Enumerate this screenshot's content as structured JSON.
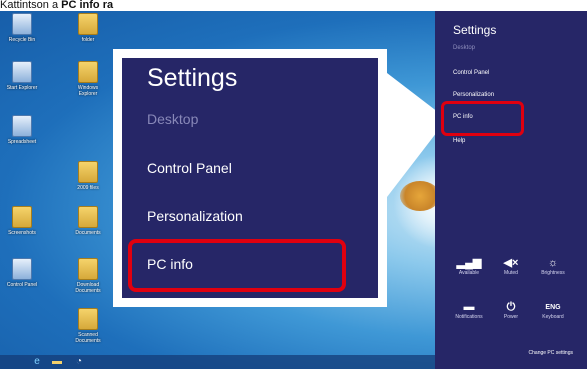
{
  "caption": {
    "prefix": "Kattintson a ",
    "bold": "PC info ra"
  },
  "desktop_icons": [
    {
      "label": "Recycle Bin",
      "kind": "app"
    },
    {
      "label": "folder",
      "kind": "folder"
    },
    {
      "label": "Start Explorer",
      "kind": "app"
    },
    {
      "label": "Windows Explorer",
      "kind": "folder"
    },
    {
      "label": "Spreadsheet",
      "kind": "app"
    },
    {
      "label": "2009 files",
      "kind": "folder"
    },
    {
      "label": "Screenshots",
      "kind": "folder"
    },
    {
      "label": "Documents",
      "kind": "folder"
    },
    {
      "label": "Control Panel",
      "kind": "app"
    },
    {
      "label": "Download Documents",
      "kind": "folder"
    },
    {
      "label": "Scanned Documents",
      "kind": "folder"
    }
  ],
  "zoom": {
    "title": "Settings",
    "items": [
      "Desktop",
      "Control Panel",
      "Personalization",
      "PC info"
    ]
  },
  "charms": {
    "title": "Settings",
    "items": [
      "Desktop",
      "Control Panel",
      "Personalization",
      "PC info",
      "Help"
    ],
    "system": [
      {
        "symbol": "▂▄▆",
        "label": "Available",
        "icon": "network-icon"
      },
      {
        "symbol": "◀×",
        "label": "Muted",
        "icon": "volume-muted-icon"
      },
      {
        "symbol": "☼",
        "label": "Brightness",
        "icon": "brightness-icon"
      },
      {
        "symbol": "▬",
        "label": "Notifications",
        "icon": "notifications-icon"
      },
      {
        "symbol": "⏻",
        "label": "Power",
        "icon": "power-icon"
      },
      {
        "symbol": "ENG",
        "label": "Keyboard",
        "icon": "keyboard-icon"
      }
    ],
    "change_settings": "Change PC settings"
  },
  "colors": {
    "charms_bg": "#262667",
    "highlight": "#e0000f",
    "desktop_bg": "#1e6fbb"
  }
}
